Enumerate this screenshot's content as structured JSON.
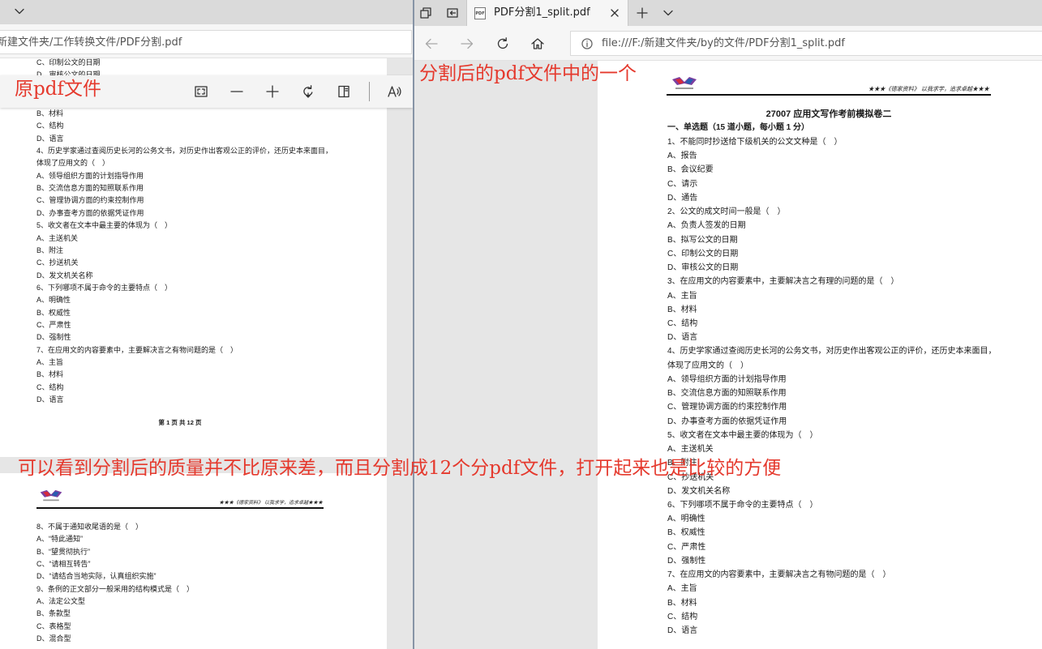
{
  "colors": {
    "annotation_red": "#e5392d",
    "chrome_gray": "#dadada",
    "viewer_gray": "#e6e6e6",
    "page_white": "#ffffff"
  },
  "annotations": {
    "left_label": "原pdf文件",
    "right_label": "分割后的pdf文件中的一个",
    "bottom_note": "可以看到分割后的质量并不比原来差，而且分割成12个分pdf文件，打开起来也是比较的方便"
  },
  "left_window": {
    "address": "新建文件夹/工作转换文件/PDF分割.pdf",
    "chrome_icons": [
      "chevron-down-icon"
    ],
    "pdf_toolbar_icons": [
      "fit-to-page-icon",
      "zoom-out-icon",
      "zoom-in-icon",
      "rotate-icon",
      "page-layout-icon",
      "read-aloud-icon"
    ],
    "page1": {
      "lines_above_toolbar": [
        "C、印制公文的日期",
        "D、审核公文的日期"
      ],
      "lines": [
        "B、材料",
        "C、结构",
        "D、语言",
        "4、历史学家通过查阅历史长河的公务文书，对历史作出客观公正的评价，还历史本来面目，",
        "体现了应用文的（　）",
        "A、领导组织方面的计划指导作用",
        "B、交流信息方面的知照联系作用",
        "C、管理协调方面的约束控制作用",
        "D、办事查考方面的依据凭证作用",
        "5、收文者在文本中最主要的体现为（　）",
        "A、主送机关",
        "B、附注",
        "C、抄送机关",
        "D、发文机关名称",
        "6、下列哪项不属于命令的主要特点（　）",
        "A、明确性",
        "B、权威性",
        "C、严肃性",
        "D、强制性",
        "7、在应用文的内容要素中，主要解决言之有物问题的是（　）",
        "A、主旨",
        "B、材料",
        "C、结构",
        "D、语言"
      ],
      "footer": "第 1 页 共 12 页"
    },
    "page2": {
      "header": "★★★《德家资料》 以我求学，追求卓越★★★",
      "lines": [
        "8、不属于通知收尾语的是（　）",
        "A、“特此通知”",
        "B、“望贯彻执行”",
        "C、“请相互转告”",
        "D、“请结合当地实际，认真组织实施”",
        "9、条例的正文部分一般采用的结构模式是（　）",
        "A、法定公文型",
        "B、条款型",
        "C、表格型",
        "D、混合型"
      ]
    }
  },
  "right_window": {
    "chrome_icons": [
      "tab-actions-icon",
      "set-aside-tabs-icon",
      "close-icon",
      "new-tab-icon",
      "chevron-down-icon",
      "back-icon",
      "forward-icon",
      "refresh-icon",
      "home-icon",
      "info-icon"
    ],
    "tab": {
      "title": "PDF分割1_split.pdf",
      "favicon_label": "PDF"
    },
    "address": "file:///F:/新建文件夹/by的文件/PDF分割1_split.pdf",
    "page": {
      "header": "★★★《德家资料》 以我求学，追求卓越★★★",
      "title": "27007 应用文写作考前模拟卷二",
      "section": "一、单选题（15 道小题，每小题 1 分）",
      "lines": [
        "1、不能同时抄送给下级机关的公文文种是（　）",
        "A、报告",
        "B、会议纪要",
        "C、请示",
        "D、通告",
        "2、公文的成文时间一般是（　）",
        "A、负责人签发的日期",
        "B、拟写公文的日期",
        "C、印制公文的日期",
        "D、审核公文的日期",
        "3、在应用文的内容要素中，主要解决言之有理的问题的是（　）",
        "A、主旨",
        "B、材料",
        "C、结构",
        "D、语言",
        "4、历史学家通过查阅历史长河的公务文书，对历史作出客观公正的评价，还历史本来面目，",
        "体现了应用文的（　）",
        "A、领导组织方面的计划指导作用",
        "B、交流信息方面的知照联系作用",
        "C、管理协调方面的约束控制作用",
        "D、办事查考方面的依据凭证作用",
        "5、收文者在文本中最主要的体现为（　）",
        "A、主送机关",
        "B、附注",
        "C、抄送机关",
        "D、发文机关名称",
        "6、下列哪项不属于命令的主要特点（　）",
        "A、明确性",
        "B、权威性",
        "C、严肃性",
        "D、强制性",
        "7、在应用文的内容要素中，主要解决言之有物问题的是（　）",
        "A、主旨",
        "B、材料",
        "C、结构",
        "D、语言"
      ]
    }
  }
}
